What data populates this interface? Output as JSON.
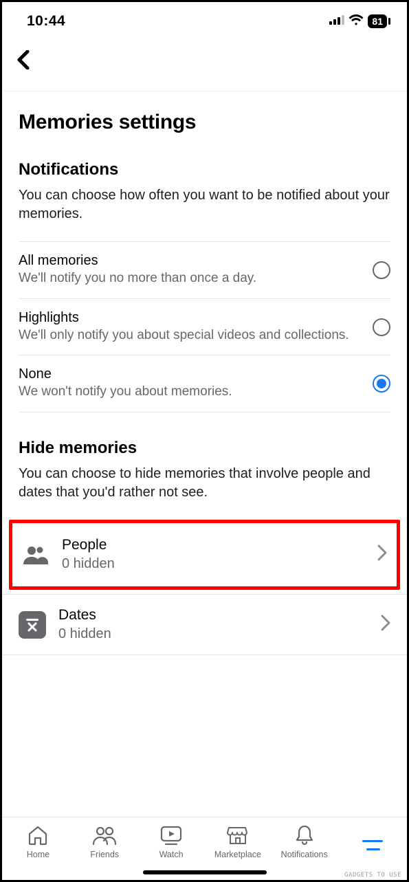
{
  "status": {
    "time": "10:44",
    "battery": "81"
  },
  "page": {
    "title": "Memories settings"
  },
  "notifications": {
    "heading": "Notifications",
    "description": "You can choose how often you want to be notified about your memories.",
    "options": [
      {
        "title": "All memories",
        "sub": "We'll notify you no more than once a day.",
        "selected": false
      },
      {
        "title": "Highlights",
        "sub": "We'll only notify you about special videos and collections.",
        "selected": false
      },
      {
        "title": "None",
        "sub": "We won't notify you about memories.",
        "selected": true
      }
    ]
  },
  "hide": {
    "heading": "Hide memories",
    "description": "You can choose to hide memories that involve people and dates that you'd rather not see.",
    "people": {
      "title": "People",
      "sub": "0 hidden"
    },
    "dates": {
      "title": "Dates",
      "sub": "0 hidden"
    }
  },
  "tabs": {
    "home": "Home",
    "friends": "Friends",
    "watch": "Watch",
    "marketplace": "Marketplace",
    "notifications": "Notifications"
  },
  "watermark": "GADGETS TO USE"
}
